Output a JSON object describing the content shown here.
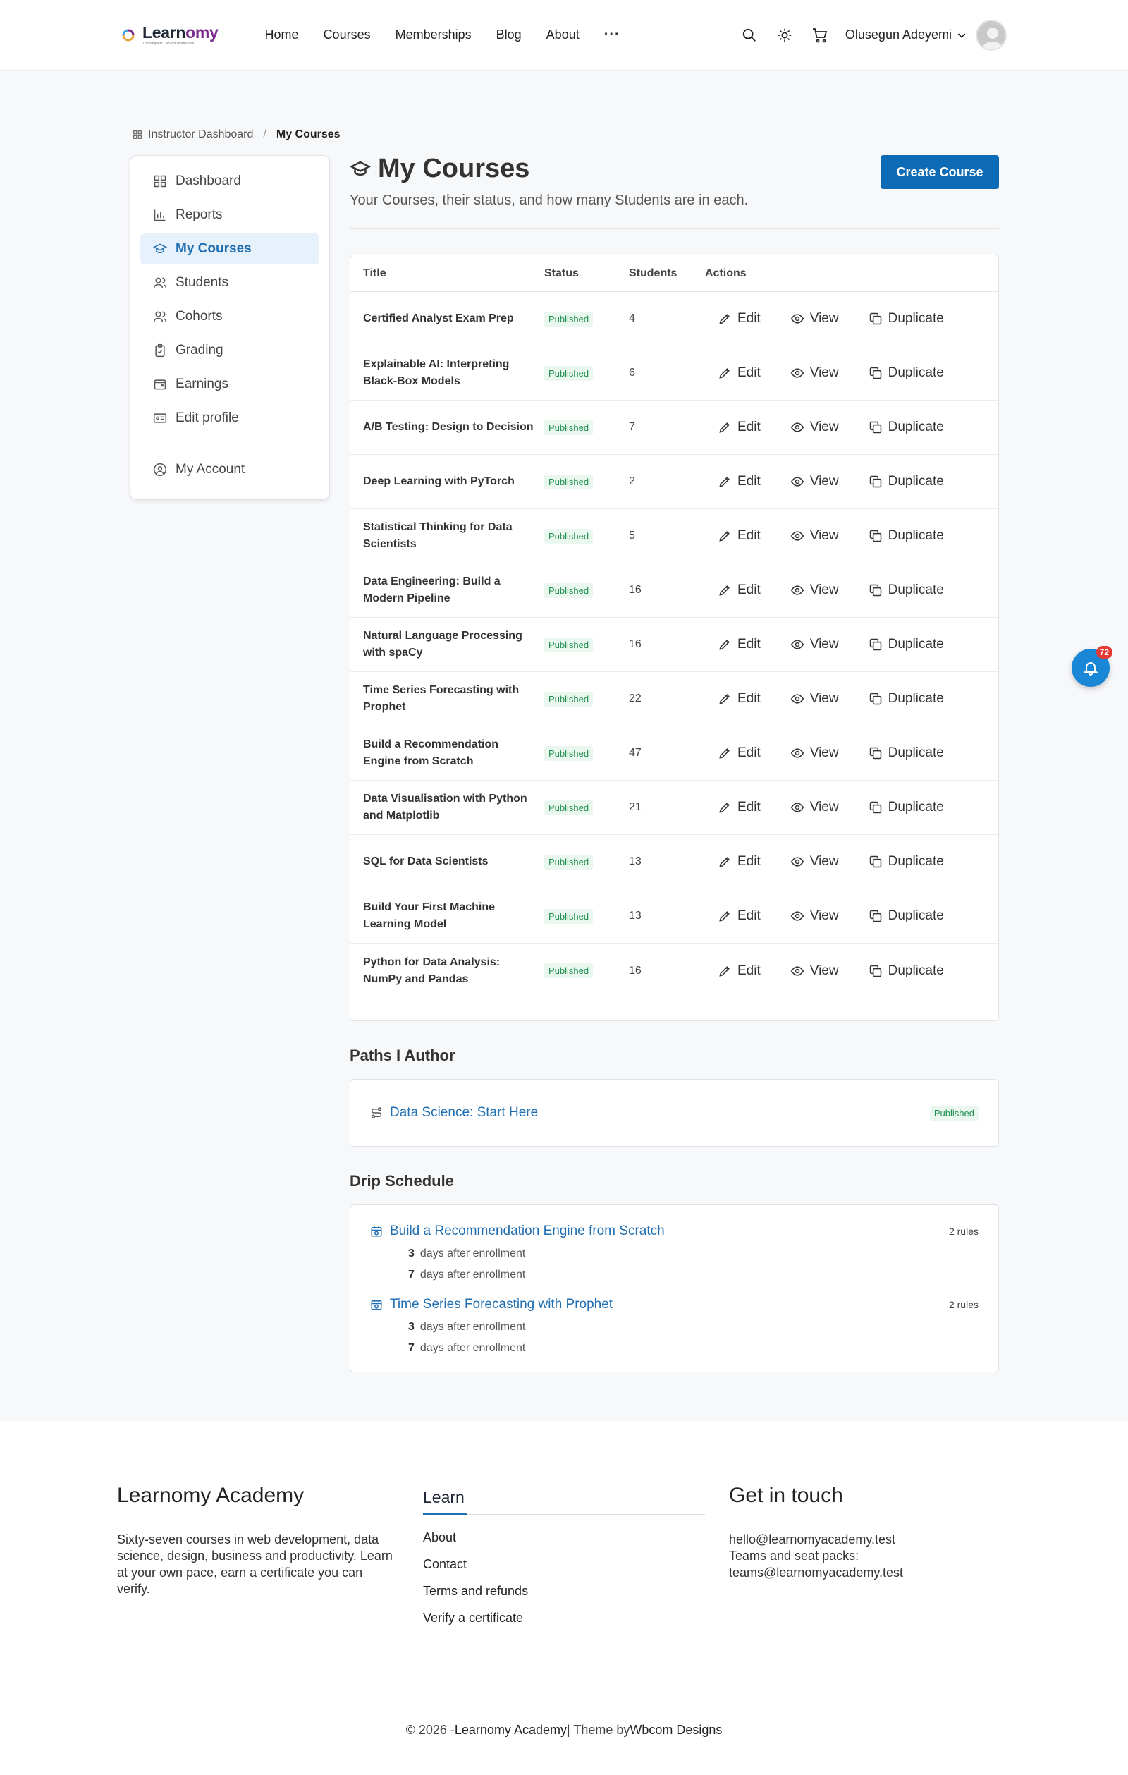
{
  "header": {
    "brand_part1": "Learn",
    "brand_part2": "omy",
    "tagline": "The simplest LMS for WordPress",
    "nav": [
      "Home",
      "Courses",
      "Memberships",
      "Blog",
      "About"
    ],
    "more": "···",
    "user_name": "Olusegun Adeyemi"
  },
  "breadcrumb": {
    "parent": "Instructor Dashboard",
    "separator": "/",
    "current": "My Courses"
  },
  "sidebar": {
    "items": [
      "Dashboard",
      "Reports",
      "My Courses",
      "Students",
      "Cohorts",
      "Grading",
      "Earnings",
      "Edit profile"
    ],
    "account": "My Account"
  },
  "page": {
    "title": "My Courses",
    "subtitle": "Your Courses, their status, and how many Students are in each.",
    "create_button": "Create Course"
  },
  "table": {
    "headers": {
      "title": "Title",
      "status": "Status",
      "students": "Students",
      "actions": "Actions"
    },
    "action_labels": {
      "edit": "Edit",
      "view": "View",
      "duplicate": "Duplicate"
    },
    "rows": [
      {
        "title": "Certified Analyst Exam Prep",
        "status": "Published",
        "students": "4"
      },
      {
        "title": "Explainable AI: Interpreting Black-Box Models",
        "status": "Published",
        "students": "6"
      },
      {
        "title": "A/B Testing: Design to Decision",
        "status": "Published",
        "students": "7"
      },
      {
        "title": "Deep Learning with PyTorch",
        "status": "Published",
        "students": "2"
      },
      {
        "title": "Statistical Thinking for Data Scientists",
        "status": "Published",
        "students": "5"
      },
      {
        "title": "Data Engineering: Build a Modern Pipeline",
        "status": "Published",
        "students": "16"
      },
      {
        "title": "Natural Language Processing with spaCy",
        "status": "Published",
        "students": "16"
      },
      {
        "title": "Time Series Forecasting with Prophet",
        "status": "Published",
        "students": "22"
      },
      {
        "title": "Build a Recommendation Engine from Scratch",
        "status": "Published",
        "students": "47"
      },
      {
        "title": "Data Visualisation with Python and Matplotlib",
        "status": "Published",
        "students": "21"
      },
      {
        "title": "SQL for Data Scientists",
        "status": "Published",
        "students": "13"
      },
      {
        "title": "Build Your First Machine Learning Model",
        "status": "Published",
        "students": "13"
      },
      {
        "title": "Python for Data Analysis: NumPy and Pandas",
        "status": "Published",
        "students": "16"
      }
    ]
  },
  "paths": {
    "heading": "Paths I Author",
    "items": [
      {
        "title": "Data Science: Start Here",
        "status": "Published"
      }
    ]
  },
  "drip": {
    "heading": "Drip Schedule",
    "groups": [
      {
        "course": "Build a Recommendation Engine from Scratch",
        "rules": "2 rules",
        "lines": [
          {
            "days": "3",
            "text": "days after enrollment"
          },
          {
            "days": "7",
            "text": "days after enrollment"
          }
        ]
      },
      {
        "course": "Time Series Forecasting with Prophet",
        "rules": "2 rules",
        "lines": [
          {
            "days": "3",
            "text": "days after enrollment"
          },
          {
            "days": "7",
            "text": "days after enrollment"
          }
        ]
      }
    ]
  },
  "notification": {
    "count": "72"
  },
  "footer": {
    "brand_title": "Learnomy Academy",
    "brand_text": "Sixty-seven courses in web development, data science, design, business and productivity. Learn at your own pace, earn a certificate you can verify.",
    "learn_title": "Learn",
    "learn_links": [
      "About",
      "Contact",
      "Terms and refunds",
      "Verify a certificate"
    ],
    "contact_title": "Get in touch",
    "contact_lines": [
      "hello@learnomyacademy.test",
      "Teams and seat packs:",
      "teams@learnomyacademy.test"
    ],
    "copyright_prefix": "© 2026 - ",
    "copyright_site": "Learnomy Academy",
    "copyright_sep": " | Theme by ",
    "copyright_theme": "Wbcom Designs"
  },
  "colors": {
    "accent": "#1f6fb2",
    "button": "#0d6ab4",
    "published_bg": "#e9f7ee",
    "published_text": "#1e8f4e",
    "notif": "#1a86d6"
  }
}
